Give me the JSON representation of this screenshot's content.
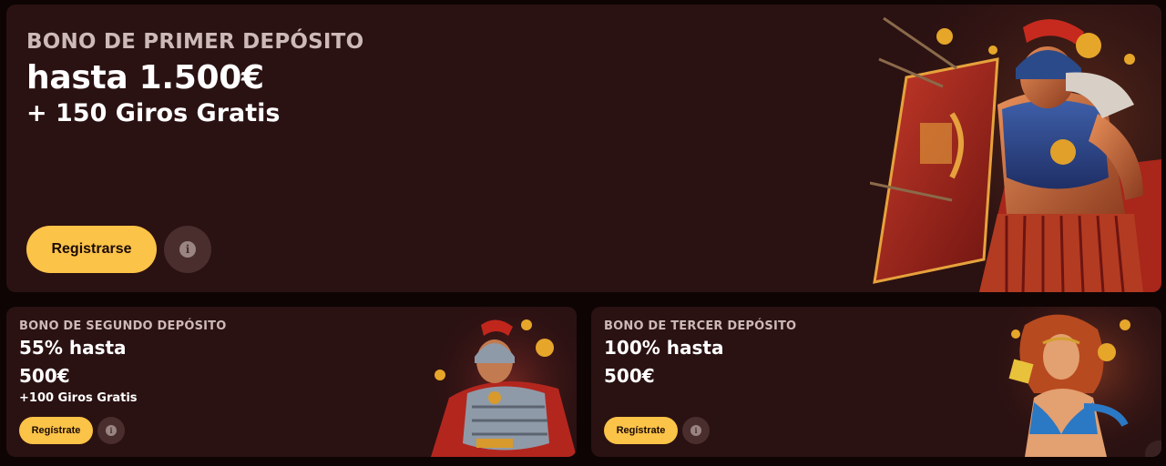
{
  "main_promo": {
    "eyebrow": "BONO DE PRIMER DEPÓSITO",
    "headline": "hasta 1.500€",
    "subline": "+ 150 Giros Gratis",
    "cta_label": "Registrarse",
    "info_icon": "info-icon",
    "info_glyph": "i"
  },
  "second_promo": {
    "eyebrow": "BONO DE SEGUNDO DEPÓSITO",
    "line1": "55% hasta",
    "line2": "500€",
    "line3": "+100 Giros Gratis",
    "cta_label": "Regístrate",
    "info_glyph": "i"
  },
  "third_promo": {
    "eyebrow": "BONO DE TERCER DEPÓSITO",
    "line1": "100% hasta",
    "line2": "500€",
    "cta_label": "Regístrate",
    "info_glyph": "i"
  },
  "colors": {
    "card_bg": "#2a1112",
    "page_bg": "#0e0404",
    "accent_yellow": "#fbc347",
    "info_bg": "#4a2e2e"
  }
}
